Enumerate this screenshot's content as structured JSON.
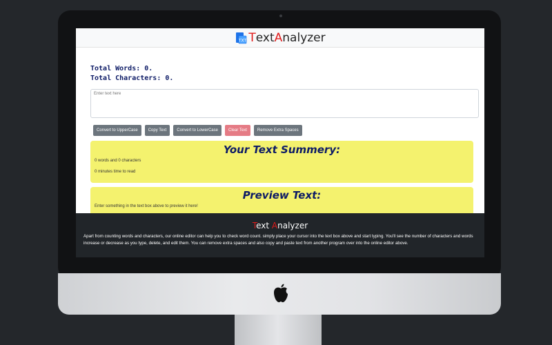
{
  "navbar": {
    "title_first": "T",
    "title_middle": "ext ",
    "title_accent": "A",
    "title_rest": "nalyzer"
  },
  "stats": {
    "words": "Total Words: 0.",
    "characters": "Total Characters: 0."
  },
  "textarea": {
    "placeholder": "Enter text here"
  },
  "buttons": {
    "uppercase": "Convert to UpperCase",
    "copy": "Copy Text",
    "lowercase": "Convert to LowerCase",
    "clear": "Clear Text",
    "remove_spaces": "Remove Extra Spaces"
  },
  "summary": {
    "title": "Your Text Summery:",
    "counts": "0 words and 0 characters",
    "time": "0 minutes time to read"
  },
  "preview": {
    "title": "Preview Text:",
    "text": "Enter something in the text box above to preview it here!"
  },
  "footer": {
    "title_first": "T",
    "title_middle": "ext ",
    "title_accent": "A",
    "title_rest": "nalyzer",
    "description": "Apart from counting words and characters, our online editor can help you to check word count. simply place your cursor into the text box above and start typing. You'll see the number of characters and words increase or decrease as you type, delete, and edit them. You can remove extra spaces and also copy and paste text from another program over into the online editor above."
  },
  "colors": {
    "accent": "#e01b1b",
    "heading": "#0d1b66",
    "card": "#f4f26e",
    "footer": "#212529"
  },
  "icons": {
    "logo": "text-document-icon",
    "apple": "apple-logo-icon"
  }
}
